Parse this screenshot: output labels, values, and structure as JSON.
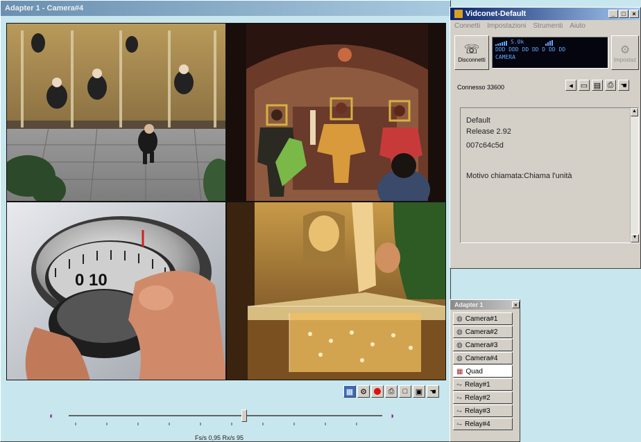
{
  "colors": {
    "desktop": "#c8e6ee",
    "titlebar_active": "#0a246a",
    "panel_gray": "#d4d0c8",
    "status_display_bg": "#050510",
    "status_display_fg": "#5fa8ff",
    "record_red": "#e01010"
  },
  "main_window": {
    "title": "Adapter 1 - Camera#4",
    "cameras": [
      {
        "name": "Camera#1",
        "scene": "overhead-mall-walkway"
      },
      {
        "name": "Camera#2",
        "scene": "shop-mannequins"
      },
      {
        "name": "Camera#3",
        "scene": "safe-dial-10"
      },
      {
        "name": "Camera#4",
        "scene": "jewelry-display-case"
      }
    ],
    "safe_dial_digits": "0  10",
    "toolbar_icons": [
      "quad-view-icon",
      "camera-grid-icon",
      "record-icon",
      "print-icon",
      "single-view-icon",
      "snapshot-icon",
      "hand-pointer-icon"
    ],
    "status_text": "Fs/s 0,95  Rx/s 95"
  },
  "vidconet_window": {
    "title": "Vidconet-Default",
    "menu": [
      "Connetti",
      "Impostazioni",
      "Strumenti",
      "Aiuto"
    ],
    "disconnect_label": "Disconnetti",
    "settings_label": "Impostaz",
    "display_lines": [
      "S.0k",
      "DDD DDD DD DD D DD DD",
      "CAMERA"
    ],
    "connection_status": "Connesso 33600",
    "info_lines": [
      "Default",
      "Release 2.92",
      "007c64c5d",
      "",
      "Motivo chiamata:Chiama l'unità"
    ]
  },
  "adapter_panel": {
    "title": "Adapter 1",
    "items": [
      {
        "label": "Camera#1",
        "icon": "camera-icon",
        "active": false
      },
      {
        "label": "Camera#2",
        "icon": "camera-icon",
        "active": false
      },
      {
        "label": "Camera#3",
        "icon": "camera-icon",
        "active": false
      },
      {
        "label": "Camera#4",
        "icon": "camera-icon",
        "active": false
      },
      {
        "label": "Quad",
        "icon": "quad-icon",
        "active": true
      },
      {
        "label": "Relay#1",
        "icon": "relay-icon",
        "active": false
      },
      {
        "label": "Relay#2",
        "icon": "relay-icon",
        "active": false
      },
      {
        "label": "Relay#3",
        "icon": "relay-icon",
        "active": false
      },
      {
        "label": "Relay#4",
        "icon": "relay-icon",
        "active": false
      }
    ]
  },
  "slider": {
    "position": 0.56
  }
}
